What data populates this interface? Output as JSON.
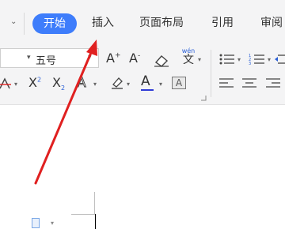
{
  "tabs": {
    "collapse_glyph": "⌄",
    "active": "开始",
    "items": [
      "插入",
      "页面布局",
      "引用",
      "审阅"
    ]
  },
  "toolbar": {
    "font_size_value": "五号",
    "grow_font_glyph": "A",
    "grow_font_sup": "+",
    "shrink_font_glyph": "A",
    "shrink_font_sup": "-",
    "phonetic_top": "wén",
    "phonetic_char": "文",
    "superscript_glyph": "X",
    "superscript_sup": "2",
    "subscript_glyph": "X",
    "subscript_sub": "2",
    "text_effect_glyph": "A",
    "font_color_glyph": "A",
    "char_shading_glyph": "A"
  },
  "colors": {
    "accent": "#3e7dfb",
    "arrow": "#e02020",
    "font_color_underline": "#2f3bd6"
  }
}
